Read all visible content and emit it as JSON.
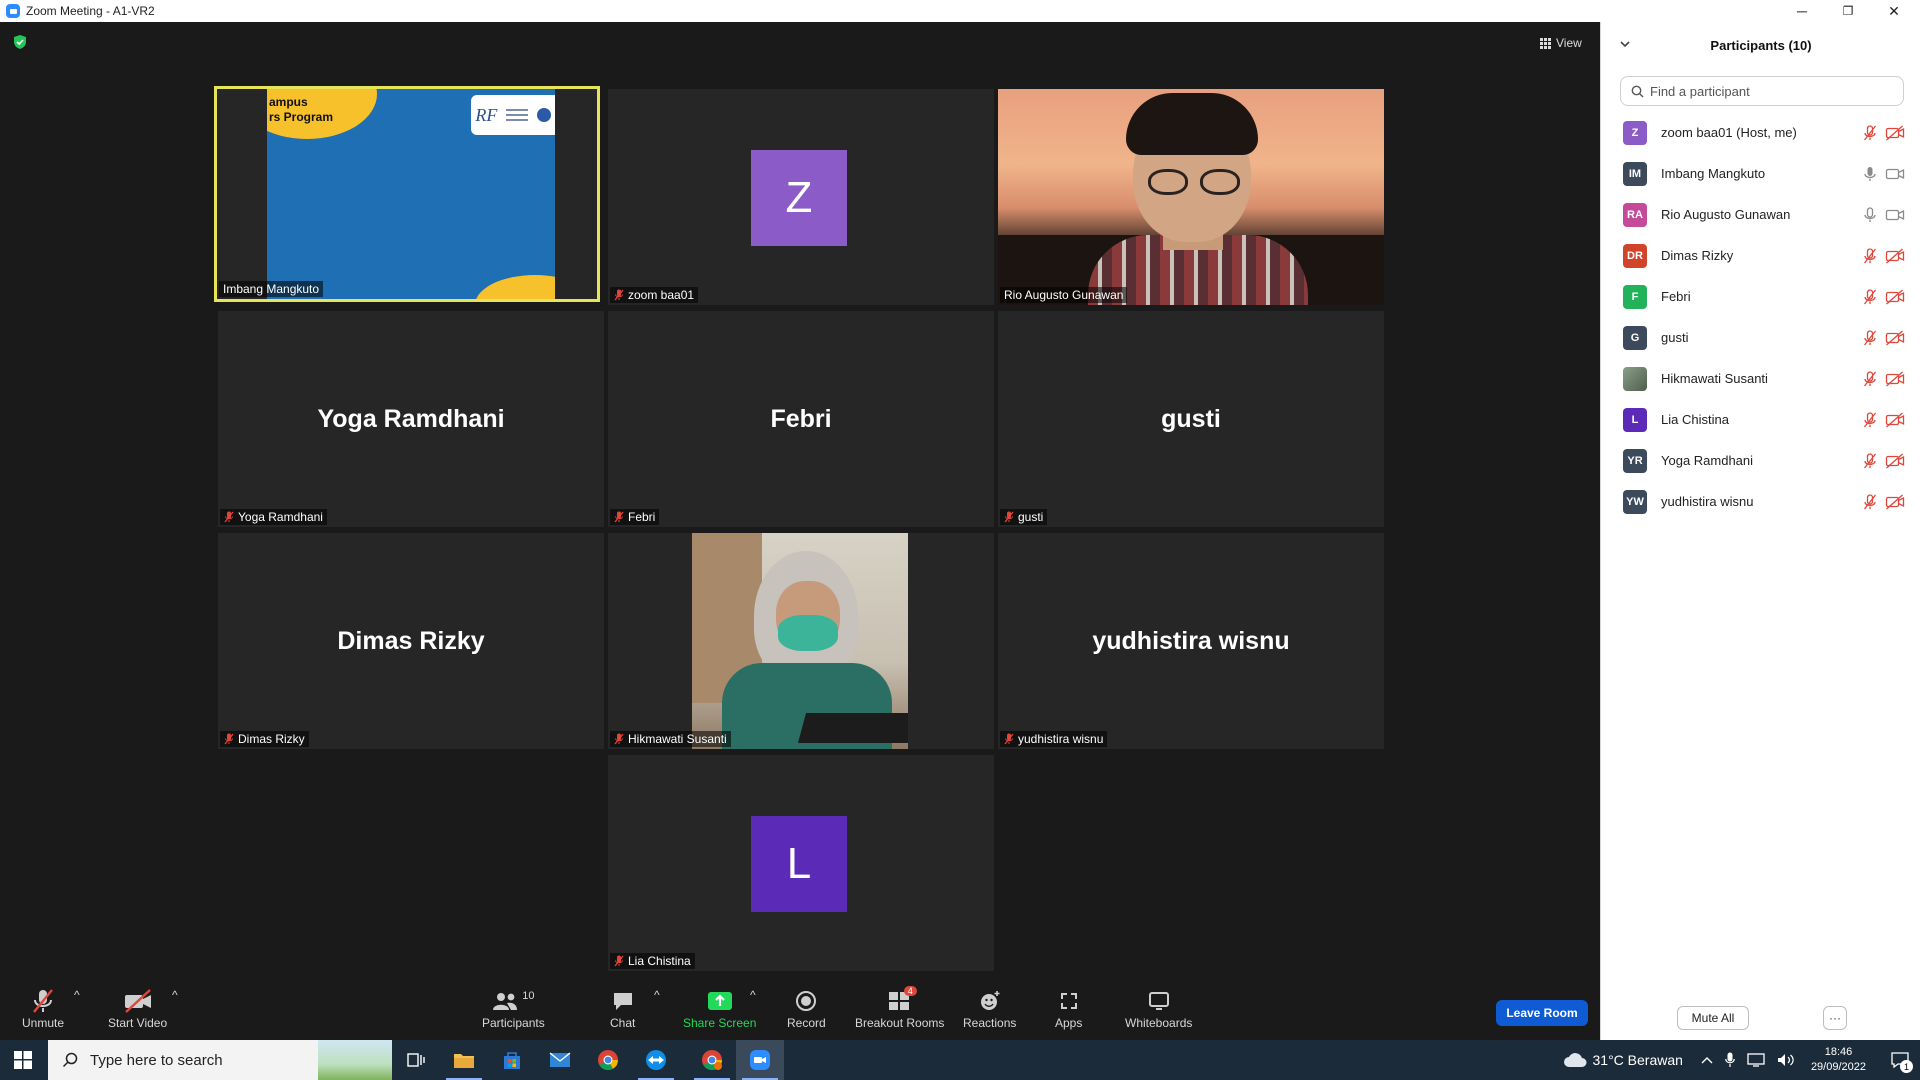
{
  "window": {
    "title": "Zoom Meeting - A1-VR2",
    "minimize": "─",
    "restore": "❐",
    "close": "✕"
  },
  "meeting": {
    "view_label": "View",
    "tiles": [
      {
        "name": "Imbang Mangkuto",
        "kind": "screenshare",
        "muted": false,
        "active": true,
        "share_caption_1": "ampus",
        "share_caption_2": "rs Program"
      },
      {
        "name": "zoom baa01",
        "kind": "avatar",
        "initial": "Z",
        "avatar_color": "#8b5cc7",
        "muted": true
      },
      {
        "name": "Rio Augusto Gunawan",
        "kind": "video",
        "muted": false
      },
      {
        "name": "Yoga Ramdhani",
        "kind": "name",
        "muted": true
      },
      {
        "name": "Febri",
        "kind": "name",
        "muted": true
      },
      {
        "name": "gusti",
        "kind": "name",
        "muted": true
      },
      {
        "name": "Dimas Rizky",
        "kind": "name",
        "muted": true
      },
      {
        "name": "Hikmawati Susanti",
        "kind": "video",
        "muted": true
      },
      {
        "name": "yudhistira wisnu",
        "kind": "name",
        "muted": true
      },
      {
        "name": "Lia Chistina",
        "kind": "avatar",
        "initial": "L",
        "avatar_color": "#5b2bb8",
        "muted": true
      }
    ]
  },
  "toolbar": {
    "unmute": "Unmute",
    "start_video": "Start Video",
    "participants": "Participants",
    "participants_count": "10",
    "chat": "Chat",
    "share_screen": "Share Screen",
    "record": "Record",
    "breakout_rooms": "Breakout Rooms",
    "breakout_badge": "4",
    "reactions": "Reactions",
    "apps": "Apps",
    "whiteboards": "Whiteboards",
    "leave_room": "Leave Room",
    "share_color": "#23d959",
    "leave_color": "#0e5bd3"
  },
  "participants_panel": {
    "title": "Participants (10)",
    "search_placeholder": "Find a participant",
    "mute_all": "Mute All",
    "more": "···",
    "items": [
      {
        "initials": "Z",
        "name": "zoom baa01 (Host, me)",
        "color": "#8b5cc7",
        "mic": "muted",
        "cam": "off"
      },
      {
        "initials": "IM",
        "name": "Imbang Mangkuto",
        "color": "#3d4a5c",
        "mic": "on",
        "cam": "on"
      },
      {
        "initials": "RA",
        "name": "Rio Augusto Gunawan",
        "color": "#c44a9a",
        "mic": "on",
        "cam": "on"
      },
      {
        "initials": "DR",
        "name": "Dimas Rizky",
        "color": "#d1432b",
        "mic": "muted",
        "cam": "off"
      },
      {
        "initials": "F",
        "name": "Febri",
        "color": "#22b35a",
        "mic": "muted",
        "cam": "off"
      },
      {
        "initials": "G",
        "name": "gusti",
        "color": "#3d4a5c",
        "mic": "muted",
        "cam": "off"
      },
      {
        "initials": "",
        "name": "Hikmawati Susanti",
        "color": "#6d7c6a",
        "mic": "muted",
        "cam": "off"
      },
      {
        "initials": "L",
        "name": "Lia Chistina",
        "color": "#5b2bb8",
        "mic": "muted",
        "cam": "off"
      },
      {
        "initials": "YR",
        "name": "Yoga Ramdhani",
        "color": "#3d4a5c",
        "mic": "muted",
        "cam": "off"
      },
      {
        "initials": "YW",
        "name": "yudhistira wisnu",
        "color": "#3d4a5c",
        "mic": "muted",
        "cam": "off"
      }
    ]
  },
  "taskbar": {
    "search_placeholder": "Type here to search",
    "weather": "31°C  Berawan",
    "time": "18:46",
    "date": "29/09/2022",
    "notification_count": "1",
    "apps": [
      "task-view-icon",
      "file-explorer-icon",
      "store-icon",
      "mail-icon",
      "chrome-icon",
      "teamviewer-icon",
      "chrome-profile-icon",
      "zoom-icon"
    ]
  }
}
